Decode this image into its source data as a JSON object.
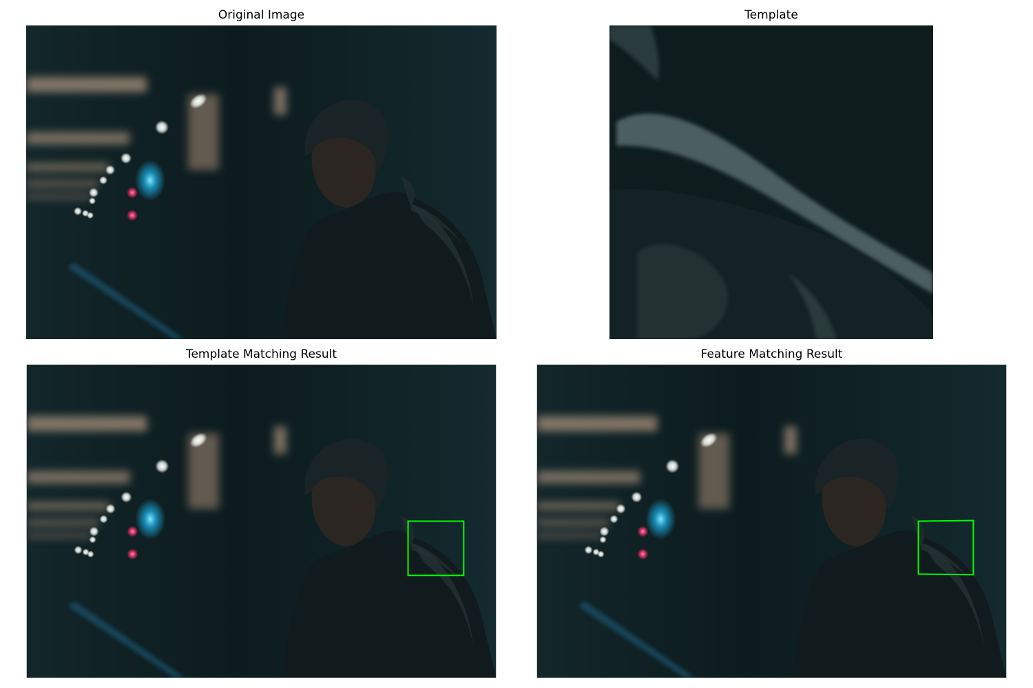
{
  "titles": {
    "original": "Original Image",
    "template": "Template",
    "template_matching": "Template Matching Result",
    "feature_matching": "Feature Matching Result"
  },
  "colors": {
    "background": "#0f1f22",
    "box": "#00ff00",
    "bokeh_white": "#f2f2ea",
    "bokeh_cyan": "#2bb6e0",
    "bokeh_pink": "#ff3f7f",
    "warm_light": "#b79f88"
  }
}
